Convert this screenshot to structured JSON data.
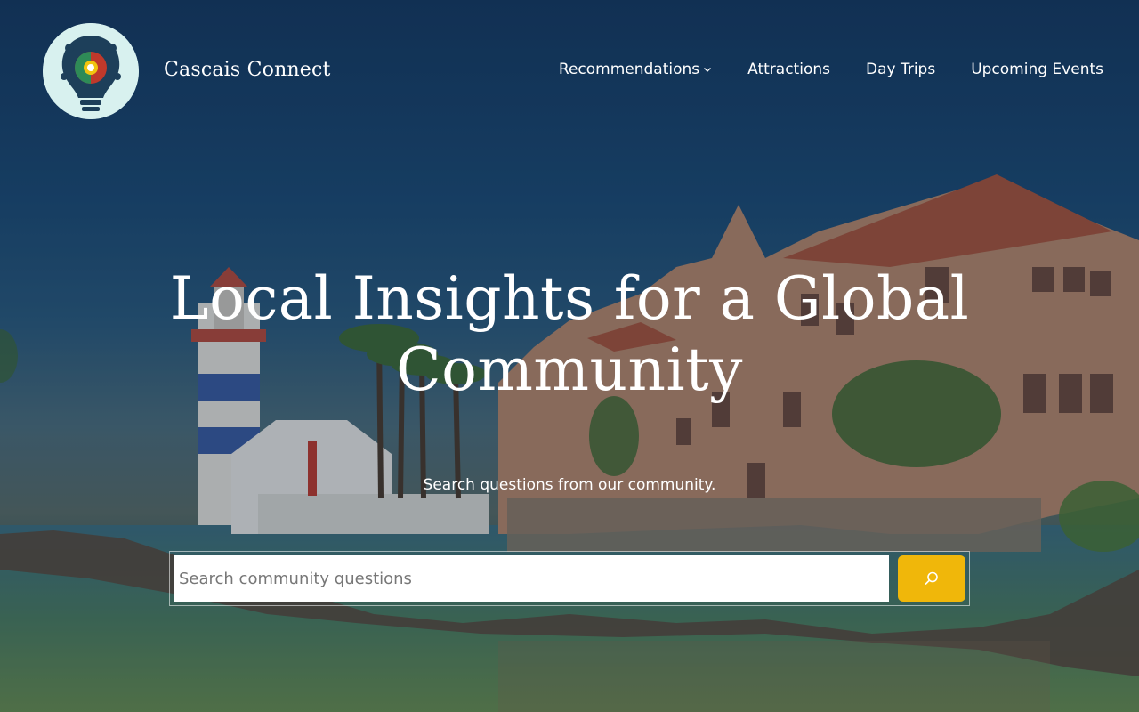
{
  "site": {
    "title": "Cascais Connect",
    "logo_icon": "lightbulb-emblem-icon"
  },
  "nav": {
    "items": [
      {
        "label": "Recommendations",
        "has_dropdown": true
      },
      {
        "label": "Attractions"
      },
      {
        "label": "Day Trips"
      },
      {
        "label": "Upcoming Events"
      }
    ]
  },
  "hero": {
    "headline": "Local Insights for a Global Community",
    "subtext": "Search questions from our community."
  },
  "search": {
    "placeholder": "Search community questions",
    "value": "",
    "button_icon": "search-icon",
    "button_color": "#f0b70a"
  }
}
